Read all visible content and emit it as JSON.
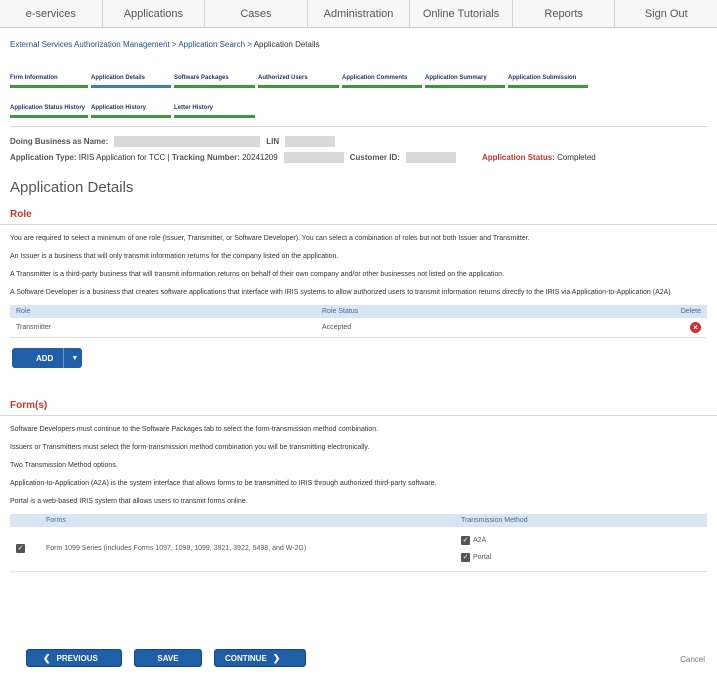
{
  "topnav": [
    "e-services",
    "Applications",
    "Cases",
    "Administration",
    "Online Tutorials",
    "Reports",
    "Sign Out"
  ],
  "breadcrumb": {
    "link": "External Services Authorization Management > Application Search > ",
    "current": "Application Details"
  },
  "tabs_row1": [
    {
      "label": "Firm Information",
      "active": false
    },
    {
      "label": "Application Details",
      "active": true
    },
    {
      "label": "Software Packages",
      "active": false
    },
    {
      "label": "Authorized Users",
      "active": false
    },
    {
      "label": "Application Comments",
      "active": false
    },
    {
      "label": "Application Summary",
      "active": false
    },
    {
      "label": "Application Submission",
      "active": false
    }
  ],
  "tabs_row2": [
    {
      "label": "Application Status History",
      "active": false
    },
    {
      "label": "Application History",
      "active": false
    },
    {
      "label": "Letter History",
      "active": false
    }
  ],
  "info": {
    "dba_label": "Doing Business as Name:",
    "lin_label": "LIN",
    "app_type_label": "Application Type:",
    "app_type": "IRIS Application for TCC",
    "tracking_label": "Tracking Number:",
    "tracking": "20241209",
    "customer_label": "Customer ID:",
    "status_label": "Application Status:",
    "status": "Completed"
  },
  "page_title": "Application Details",
  "role": {
    "title": "Role",
    "p1": "You are required to select a minimum of one role (Issuer, Transmitter, or Software Developer). You can select a combination of roles but not both Issuer and Transmitter.",
    "p2": "An Issuer is a business that will only transmit information returns for the company listed on the application.",
    "p3": "A Transmitter is a third-party business that will transmit information returns on behalf of their own company and/or other businesses not listed on the application.",
    "p4": "A Software Developer is a business that creates software applications that interface with IRIS systems to allow authorized users to transmit information returns directly to the IRIS via Application-to-Application (A2A)",
    "headers": {
      "role": "Role",
      "status": "Role Status",
      "delete": "Delete"
    },
    "rows": [
      {
        "role": "Transmitter",
        "status": "Accepted"
      }
    ],
    "add_label": "ADD"
  },
  "forms": {
    "title": "Form(s)",
    "p1": "Software Developers must continue to the Software Packages tab to select the form-transmission method combination.",
    "p2": "Issuers or Transmitters must select the form-transmission method combination you will be transmitting electronically.",
    "p3": "Two Transmission Method options.",
    "p4": "Application-to-Application (A2A) is the system interface that allows forms to be transmitted to IRIS through authorized third-party software.",
    "p5": "Portal is a web-based IRIS system that allows users to transmit forms online.",
    "headers": {
      "forms": "Forms",
      "method": "Transmission Method"
    },
    "rows": [
      {
        "form": "Form 1099 Series (includes Forms 1097, 1098, 1099, 3921, 3922, 5498, and W-2G)",
        "methods": [
          "A2A",
          "Portal"
        ]
      }
    ]
  },
  "buttons": {
    "previous": "PREVIOUS",
    "save": "SAVE",
    "continue": "CONTINUE",
    "cancel": "Cancel"
  },
  "colors": {
    "accent_blue": "#1f5fa8",
    "tab_green": "#3a9a3a",
    "status_red": "#c0392b",
    "table_header": "#d7e6f2"
  }
}
